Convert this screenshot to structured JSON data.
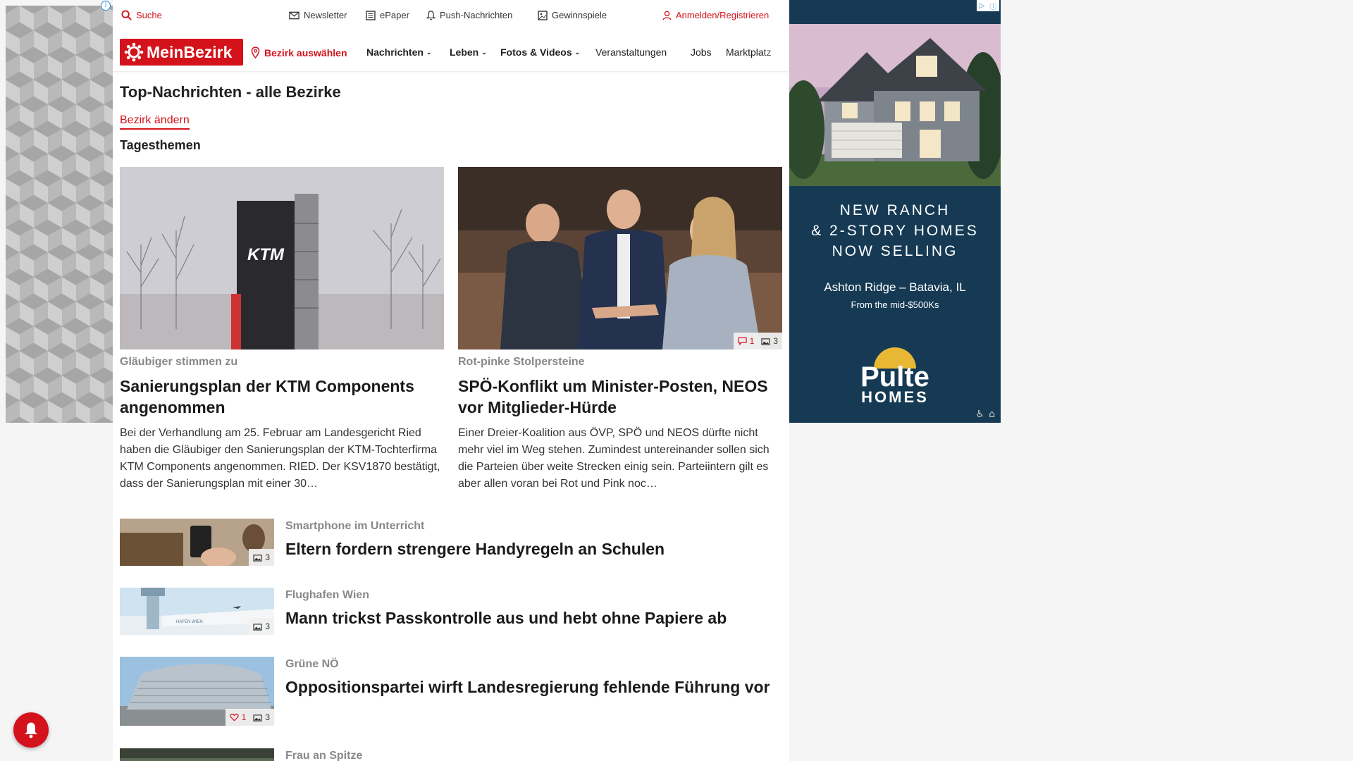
{
  "header": {
    "search_label": "Suche",
    "utility_links": [
      {
        "label": "Newsletter",
        "icon": "mail-icon"
      },
      {
        "label": "ePaper",
        "icon": "newspaper-icon"
      },
      {
        "label": "Push-Nachrichten",
        "icon": "bell-icon"
      },
      {
        "label": "Gewinnspiele",
        "icon": "gift-icon"
      }
    ],
    "login_label": "Anmelden/Registrieren"
  },
  "nav": {
    "logo_text": "MeinBezirk",
    "bezirk_label": "Bezirk auswählen",
    "items": [
      {
        "label": "Nachrichten",
        "has_dropdown": true
      },
      {
        "label": "Leben",
        "has_dropdown": true
      },
      {
        "label": "Fotos & Videos",
        "has_dropdown": true
      },
      {
        "label": "Veranstaltungen",
        "has_dropdown": false
      },
      {
        "label": "Jobs",
        "has_dropdown": false
      },
      {
        "label": "Marktplatz",
        "has_dropdown": false
      }
    ]
  },
  "main": {
    "page_title": "Top-Nachrichten - alle Bezirke",
    "change_district": "Bezirk ändern",
    "section_title": "Tagesthemen",
    "featured": [
      {
        "kicker": "Gläubiger stimmen zu",
        "title": "Sanierungsplan der KTM Components angenommen",
        "teaser": "Bei der Verhandlung am 25. Februar am Landesgericht Ried haben die Gläubiger den Sanierungsplan der KTM-Tochterfirma KTM Components angenommen. RIED. Der KSV1870 bestätigt, dass der Sanierungsplan mit einer 30…",
        "image_text": "KTM",
        "comments": "",
        "photos": ""
      },
      {
        "kicker": "Rot-pinke Stolpersteine",
        "title": "SPÖ-Konflikt um Minister-Posten, NEOS vor Mitglieder-Hürde",
        "teaser": "Einer Dreier-Koalition aus ÖVP, SPÖ und NEOS dürfte nicht mehr viel im Weg stehen. Zumindest untereinander sollen sich die Parteien über weite Strecken einig sein. Parteiintern gilt es aber allen voran bei Rot und Pink noc…",
        "comments": "1",
        "photos": "3"
      }
    ],
    "list": [
      {
        "kicker": "Smartphone im Unterricht",
        "title": "Eltern fordern strengere Handyregeln an Schulen",
        "likes": "",
        "photos": "3"
      },
      {
        "kicker": "Flughafen Wien",
        "title": "Mann trickst Passkontrolle aus und hebt ohne Papiere ab",
        "likes": "",
        "photos": "3",
        "image_text": "HAFEN WIEN"
      },
      {
        "kicker": "Grüne NÖ",
        "title": "Oppositionspartei wirft Landesregierung fehlende Führung vor",
        "likes": "1",
        "photos": "3"
      },
      {
        "kicker": "Frau an Spitze",
        "title": "",
        "likes": "",
        "photos": ""
      }
    ]
  },
  "ad": {
    "headline_lines": [
      "NEW RANCH",
      "& 2-STORY HOMES",
      "NOW SELLING"
    ],
    "location": "Ashton Ridge – Batavia, IL",
    "price": "From the mid-$500Ks",
    "brand_top": "Pulte",
    "brand_bottom": "HOMES"
  },
  "colors": {
    "brand_red": "#d4121b",
    "ad_navy": "#163a54"
  }
}
